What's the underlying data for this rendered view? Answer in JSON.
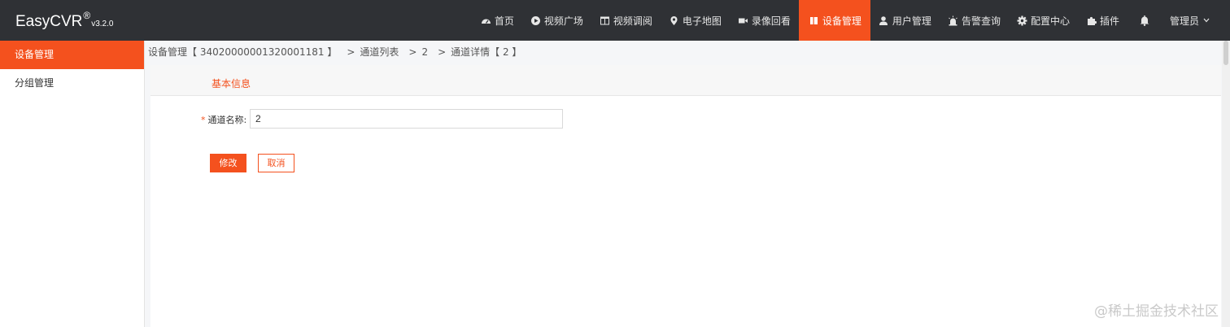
{
  "brand": {
    "name": "EasyCVR",
    "reg": "®",
    "version": "v3.2.0"
  },
  "nav": {
    "items": [
      {
        "label": "首页",
        "icon": "dashboard-icon"
      },
      {
        "label": "视频广场",
        "icon": "play-circle-icon"
      },
      {
        "label": "视频调阅",
        "icon": "grid-icon"
      },
      {
        "label": "电子地图",
        "icon": "map-pin-icon"
      },
      {
        "label": "录像回看",
        "icon": "video-camera-icon"
      },
      {
        "label": "设备管理",
        "icon": "device-icon",
        "active": true
      },
      {
        "label": "用户管理",
        "icon": "user-icon"
      },
      {
        "label": "告警查询",
        "icon": "alarm-icon"
      },
      {
        "label": "配置中心",
        "icon": "gear-icon"
      },
      {
        "label": "插件",
        "icon": "puzzle-icon"
      }
    ],
    "user": "管理员"
  },
  "sidebar": {
    "items": [
      {
        "label": "设备管理",
        "active": true
      },
      {
        "label": "分组管理"
      }
    ]
  },
  "breadcrumb": {
    "device": "设备管理【 34020000001320001181 】",
    "list": "通道列表",
    "channel": "2",
    "detail": "通道详情【 2 】"
  },
  "form": {
    "section_title": "基本信息",
    "required_mark": "*",
    "channel_name_label": "通道名称:",
    "channel_name_value": "2",
    "submit_label": "修改",
    "cancel_label": "取消"
  },
  "watermark": "@稀土掘金技术社区",
  "colors": {
    "accent": "#f4511e",
    "topbar": "#2f3135"
  }
}
